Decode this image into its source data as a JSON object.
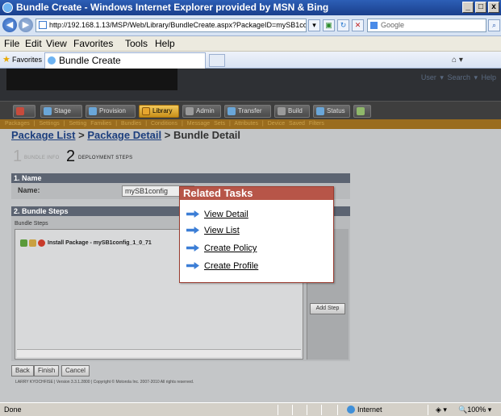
{
  "window": {
    "title": "Bundle Create - Windows Internet Explorer provided by MSN & Bing",
    "min": "_",
    "max": "□",
    "close": "x"
  },
  "addressbar": {
    "url": "http://192.168.1.13/MSP/Web/Library/BundleCreate.aspx?PackageID=mySB1config...",
    "search_placeholder": "Google"
  },
  "menu": [
    "File",
    "Edit",
    "View",
    "Favorites",
    "Tools",
    "Help"
  ],
  "favorites": {
    "label": "Favorites",
    "tab_title": "Bundle Create"
  },
  "app": {
    "user_nav": "User ▾   Search ▾   Help",
    "tabs": [
      {
        "label": "",
        "color": "#c74b3c"
      },
      {
        "label": "Stage",
        "color": "#6aa6d8"
      },
      {
        "label": "Provision",
        "color": "#6aa6d8"
      },
      {
        "label": "Library",
        "color": "#e7a62e"
      },
      {
        "label": "Admin",
        "color": "#9a9a9a"
      },
      {
        "label": "Transfer",
        "color": "#6aa6d8"
      },
      {
        "label": "Build",
        "color": "#9a9a9a"
      },
      {
        "label": "Status",
        "color": "#6aa6d8"
      },
      {
        "label": "",
        "color": "#8fb86a"
      }
    ],
    "subnav": "Packages  |  Settings  |  Setting Families  |  Bundles  |  Conditions  |  Message Sets  |  Attributes  |  Device Saved Filters"
  },
  "breadcrumb": {
    "link1": "Package List",
    "sep1": ">",
    "link2": "Package Detail",
    "sep2": ">",
    "current": "Bundle Detail"
  },
  "steps": {
    "step1_num": "1",
    "step1_label": "BUNDLE INFO",
    "step2_num": "2",
    "step2_label": "DEPLOYMENT STEPS"
  },
  "name_section": {
    "header": "1. Name",
    "label": "Name:",
    "value": "mySB1config"
  },
  "bundle_steps": {
    "header": "2. Bundle Steps",
    "legend": "Bundle Steps",
    "row": "Install Package - mySB1config_1_0_71",
    "add_step": "Add Step"
  },
  "actions": {
    "back": "Back",
    "finish": "Finish",
    "cancel": "Cancel"
  },
  "footer": "LARRY KYOCHFISE | Version 3.3.1.2800 | Copyright © Motorola Inc. 2007-2010 All rights reserved.",
  "related_tasks": {
    "title": "Related Tasks",
    "items": [
      "View Detail",
      "View List",
      "Create Policy",
      "Create Profile"
    ]
  },
  "statusbar": {
    "status": "Done",
    "zone": "Internet",
    "zoom": "100%"
  }
}
